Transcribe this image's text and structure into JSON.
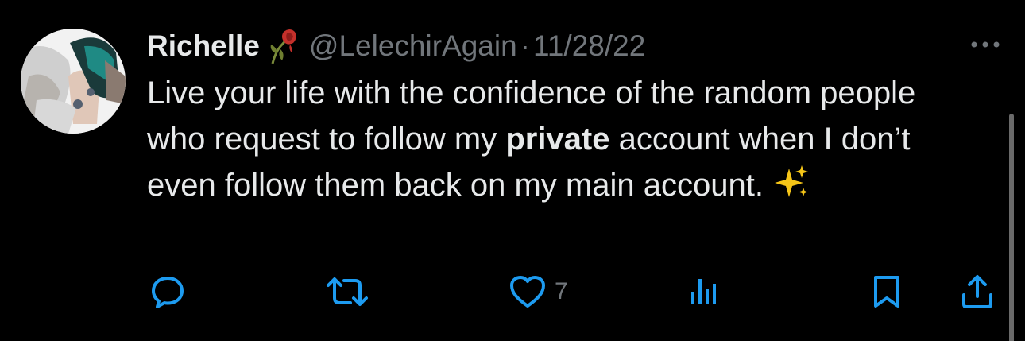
{
  "author": {
    "display_name": "Richelle",
    "name_emoji": "wilted-rose-emoji",
    "handle": "@LelechirAgain",
    "separator": "·",
    "date": "11/28/22",
    "avatar": "profile-photo"
  },
  "tweet": {
    "text_before_bold": "Live your life with the confidence of the random people who request to follow my ",
    "text_bold": "private",
    "text_after_bold": " account when I don’t even follow them back on my main account.",
    "trailing_emoji": "sparkles-emoji"
  },
  "actions": {
    "reply_icon": "reply-icon",
    "retweet_icon": "retweet-icon",
    "like_icon": "heart-icon",
    "like_count": "7",
    "views_icon": "views-bar-chart-icon",
    "bookmark_icon": "bookmark-icon",
    "share_icon": "share-icon"
  },
  "more_icon": "more-options-icon",
  "colors": {
    "background": "#000000",
    "primary_text": "#e7e9ea",
    "secondary_text": "#71767b",
    "icon_blue": "#1d9bf0"
  }
}
